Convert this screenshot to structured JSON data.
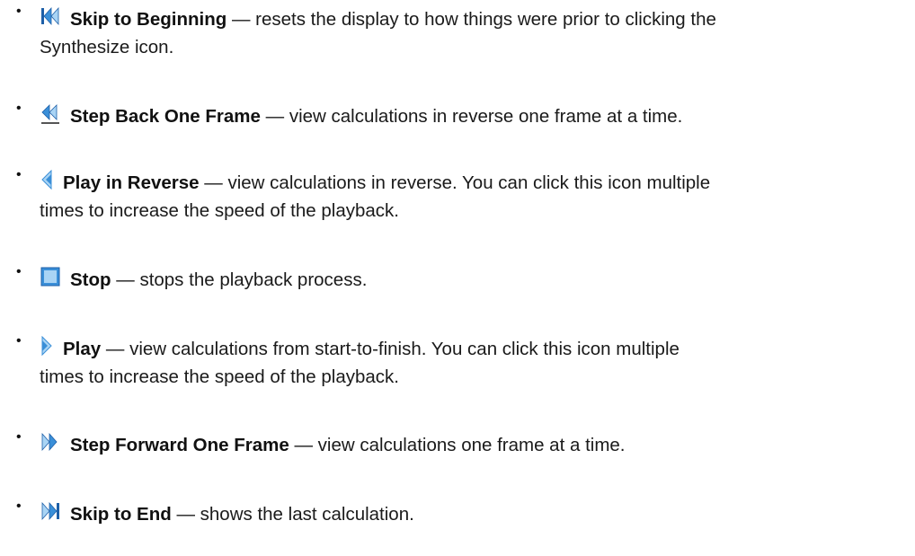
{
  "items": [
    {
      "icon": "skip-to-beginning-icon",
      "label": "Skip to Beginning",
      "desc_line1": " — resets the display to how things were prior to clicking the",
      "desc_line2": "Synthesize icon."
    },
    {
      "icon": "step-back-one-frame-icon",
      "label": "Step Back One Frame",
      "desc_line1": " — view calculations in reverse one frame at a time."
    },
    {
      "icon": "play-in-reverse-icon",
      "label": "Play in Reverse",
      "desc_line1": " — view calculations in reverse. You can click this icon multiple",
      "desc_line2": "times to increase the speed of the playback."
    },
    {
      "icon": "stop-icon",
      "label": "Stop",
      "desc_line1": " — stops the playback process."
    },
    {
      "icon": "play-icon",
      "label": "Play",
      "desc_line1": " — view calculations from start-to-finish. You can click this icon multiple",
      "desc_line2": "times to increase the speed of the playback."
    },
    {
      "icon": "step-forward-one-frame-icon",
      "label": "Step Forward One Frame",
      "desc_line1": " — view calculations one frame at a time."
    },
    {
      "icon": "skip-to-end-icon",
      "label": "Skip to End",
      "desc_line1": " — shows the last calculation."
    }
  ],
  "colors": {
    "icon_blue": "#3a8fd8",
    "icon_light": "#a9d4f5",
    "icon_dark": "#1d5fa8"
  }
}
